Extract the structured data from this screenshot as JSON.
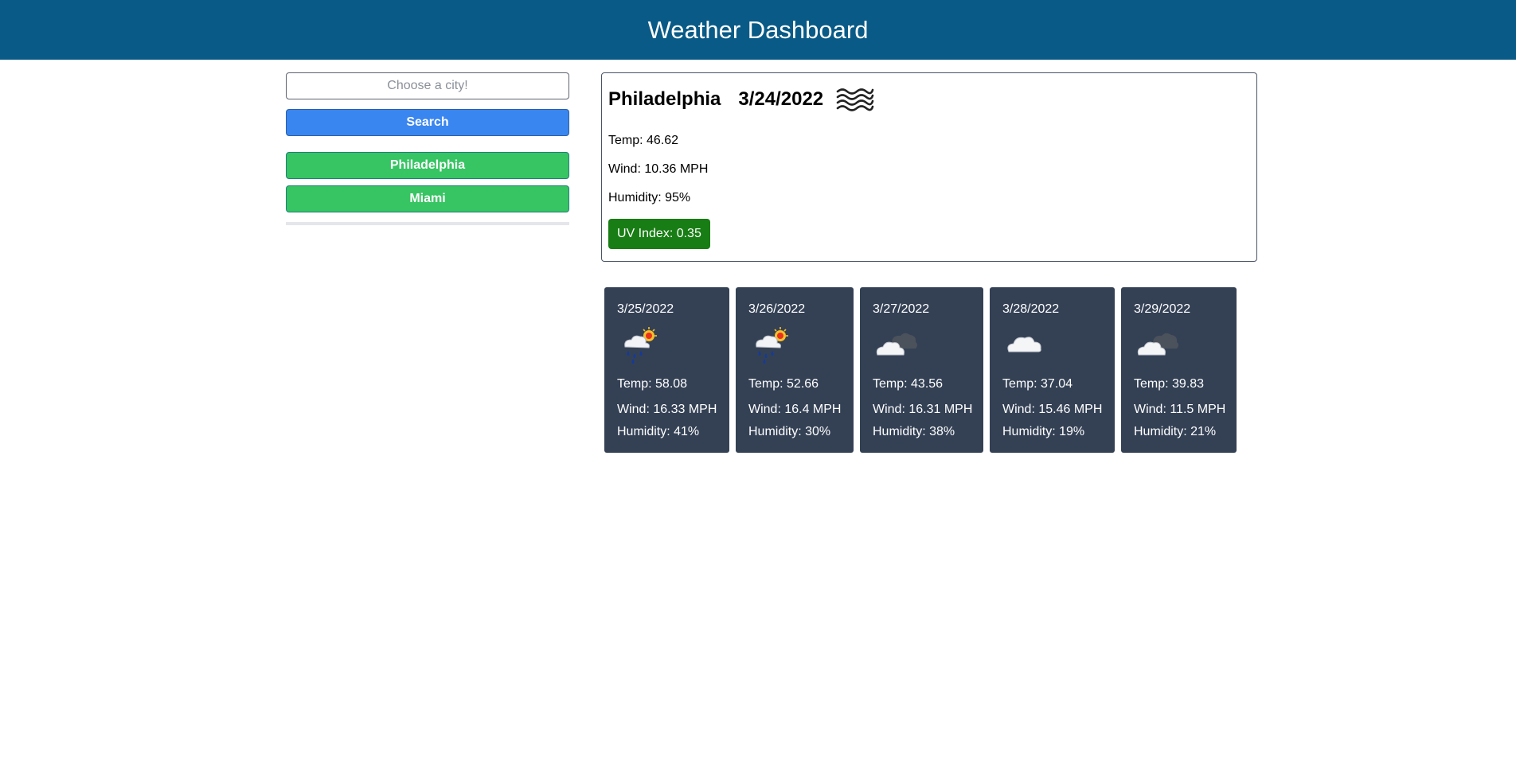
{
  "header": {
    "title": "Weather Dashboard"
  },
  "search": {
    "placeholder": "Choose a city!",
    "value": "",
    "button_label": "Search"
  },
  "history": [
    "Philadelphia",
    "Miami"
  ],
  "current": {
    "city": "Philadelphia",
    "date": "3/24/2022",
    "icon": "mist-icon",
    "temp": "Temp: 46.62",
    "wind": "Wind: 10.36 MPH",
    "humidity": "Humidity: 95%",
    "uv": "UV Index: 0.35",
    "uv_color": "#187d14"
  },
  "forecast": [
    {
      "date": "3/25/2022",
      "icon": "rain-sun-icon",
      "temp": "Temp: 58.08",
      "wind": "Wind: 16.33 MPH",
      "humidity": "Humidity: 41%"
    },
    {
      "date": "3/26/2022",
      "icon": "rain-sun-icon",
      "temp": "Temp: 52.66",
      "wind": "Wind: 16.4 MPH",
      "humidity": "Humidity: 30%"
    },
    {
      "date": "3/27/2022",
      "icon": "broken-clouds-icon",
      "temp": "Temp: 43.56",
      "wind": "Wind: 16.31 MPH",
      "humidity": "Humidity: 38%"
    },
    {
      "date": "3/28/2022",
      "icon": "cloud-icon",
      "temp": "Temp: 37.04",
      "wind": "Wind: 15.46 MPH",
      "humidity": "Humidity: 19%"
    },
    {
      "date": "3/29/2022",
      "icon": "broken-clouds-icon",
      "temp": "Temp: 39.83",
      "wind": "Wind: 11.5 MPH",
      "humidity": "Humidity: 21%"
    }
  ],
  "colors": {
    "header_bg": "#095a86",
    "search_button": "#3a86f0",
    "history_button": "#37c463",
    "forecast_card": "#344155"
  }
}
